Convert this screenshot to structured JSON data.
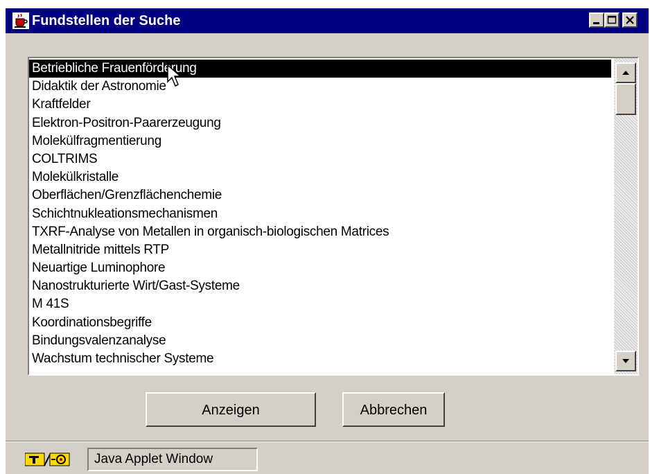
{
  "window": {
    "title": "Fundstellen der Suche",
    "icon": "coffee-cup-icon"
  },
  "controls": {
    "minimize_icon": "minimize-icon",
    "maximize_icon": "maximize-icon",
    "close_icon": "close-icon"
  },
  "results": {
    "selected_index": 0,
    "items": [
      "Betriebliche Frauenförderung",
      "Didaktik der Astronomie",
      "Kraftfelder",
      "Elektron-Positron-Paarerzeugung",
      "Molekülfragmentierung",
      "COLTRIMS",
      "Molekülkristalle",
      "Oberflächen/Grenzflächenchemie",
      "Schichtnukleationsmechanismen",
      "TXRF-Analyse von Metallen in organisch-biologischen Matrices",
      "Metallnitride mittels RTP",
      "Neuartige Luminophore",
      "Nanostrukturierte Wirt/Gast-Systeme",
      "M 41S",
      "Koordinationsbegriffe",
      "Bindungsvalenzanalyse",
      "Wachstum technischer Systeme"
    ]
  },
  "buttons": {
    "show": "Anzeigen",
    "cancel": "Abbrechen"
  },
  "status": {
    "icon": "java-applet-icon",
    "text": "Java Applet Window"
  },
  "colors": {
    "titlebar": "#000080",
    "face": "#d4d0c8",
    "selection": "#000000"
  }
}
